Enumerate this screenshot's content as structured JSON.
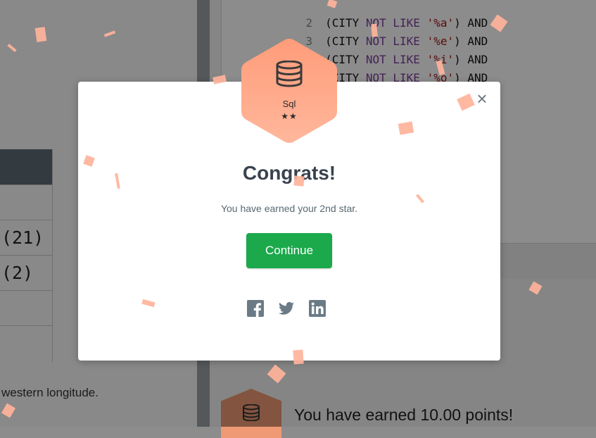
{
  "background": {
    "left_table_rows": [
      "",
      "(21)",
      "(2)",
      "",
      ""
    ],
    "left_description": "western longitude.",
    "code_lines": [
      {
        "num": "2",
        "pre": "(CITY ",
        "kw": "NOT LIKE ",
        "str": "'%a'",
        "post": ") AND"
      },
      {
        "num": "3",
        "pre": "(CITY ",
        "kw": "NOT LIKE ",
        "str": "'%e'",
        "post": ") AND"
      },
      {
        "num": "4",
        "pre": "(CITY ",
        "kw": "NOT LIKE ",
        "str": "'%i'",
        "post": ") AND"
      },
      {
        "num": "5",
        "pre": "(CITY ",
        "kw": "NOT LIKE ",
        "str": "'%o'",
        "post": ") AND"
      }
    ],
    "points_message": "You have earned 10.00 points!"
  },
  "modal": {
    "badge": {
      "name": "Sql",
      "stars": "★★",
      "icon": "database-icon",
      "color": "#ff9e7d"
    },
    "title": "Congrats!",
    "message": "You have earned your 2nd star.",
    "continue_label": "Continue",
    "close_label": "×",
    "share": [
      "facebook-icon",
      "twitter-icon",
      "linkedin-icon"
    ]
  },
  "colors": {
    "continue_green": "#1ba94c",
    "badge_peach": "#ff9e7d",
    "confetti": "#ffb39b"
  }
}
